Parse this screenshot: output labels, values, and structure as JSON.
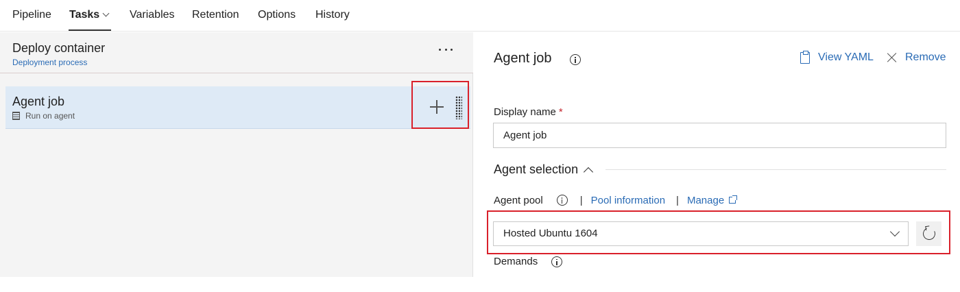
{
  "tabs": [
    {
      "label": "Pipeline"
    },
    {
      "label": "Tasks"
    },
    {
      "label": "Variables"
    },
    {
      "label": "Retention"
    },
    {
      "label": "Options"
    },
    {
      "label": "History"
    }
  ],
  "active_tab": "Tasks",
  "left": {
    "title": "Deploy container",
    "subtitle": "Deployment process",
    "job": {
      "title": "Agent job",
      "subtitle": "Run on agent"
    }
  },
  "right": {
    "title": "Agent job",
    "view_yaml": "View YAML",
    "remove": "Remove",
    "display_name_label": "Display name",
    "required_mark": "*",
    "display_name_value": "Agent job",
    "agent_selection_title": "Agent selection",
    "agent_pool_label": "Agent pool",
    "separator": "|",
    "pool_information": "Pool information",
    "manage": "Manage",
    "agent_pool_value": "Hosted Ubuntu 1604",
    "demands_label": "Demands"
  },
  "colors": {
    "link": "#2a6bb5",
    "highlight_box": "#d9202a",
    "selected_row": "#deeaf6"
  }
}
